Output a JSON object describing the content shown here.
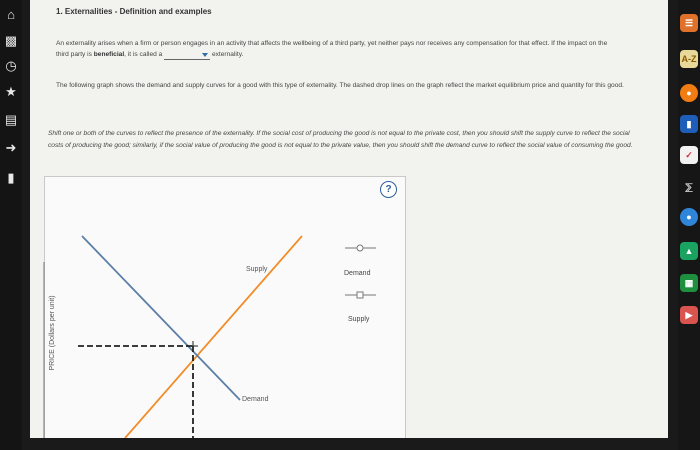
{
  "question": {
    "title": "1. Externalities - Definition and examples",
    "para1": {
      "text_before": "An externality arises when a firm or person engages in an activity that affects the wellbeing of a third party, yet neither pays nor receives any compensation for that effect. If the impact on the third party is ",
      "bold": "beneficial",
      "text_middle": ", it is called a ",
      "text_after": " externality."
    },
    "para2": "The following graph shows the demand and supply curves for a good with this type of externality. The dashed drop lines on the graph reflect the market equilibrium price and quantity for this good.",
    "para3": "Shift one or both of the curves to reflect the presence of the externality. If the social cost of producing the good is not equal to the private cost, then you should shift the supply curve to reflect the social costs of producing the good; similarly, if the social value of producing the good is not equal to the private value, then you should shift the demand curve to reflect the social value of consuming the good."
  },
  "graph": {
    "help_label": "?",
    "y_axis_label": "PRICE (Dollars per unit)",
    "supply_curve_label": "Supply",
    "demand_curve_label": "Demand",
    "legend": [
      {
        "name": "Demand",
        "marker": "circle"
      },
      {
        "name": "Supply",
        "marker": "square"
      }
    ]
  },
  "colors": {
    "supply": "#f28c28",
    "demand": "#5b7fa6",
    "dashed": "#222222",
    "accent": "#2e5e9a"
  },
  "sidebar_left_icons": [
    "home-icon",
    "cards-icon",
    "clock-icon",
    "star-icon",
    "book-icon"
  ],
  "sidebar_right_icons": [
    "highlight-icon",
    "a-z-icon",
    "circle-icon",
    "pencil-icon",
    "flashcard-icon",
    "cloud-icon",
    "drive-icon",
    "sheets-icon",
    "app-icon"
  ],
  "sidebar_right_labels": {
    "a_z": "A-Z"
  }
}
